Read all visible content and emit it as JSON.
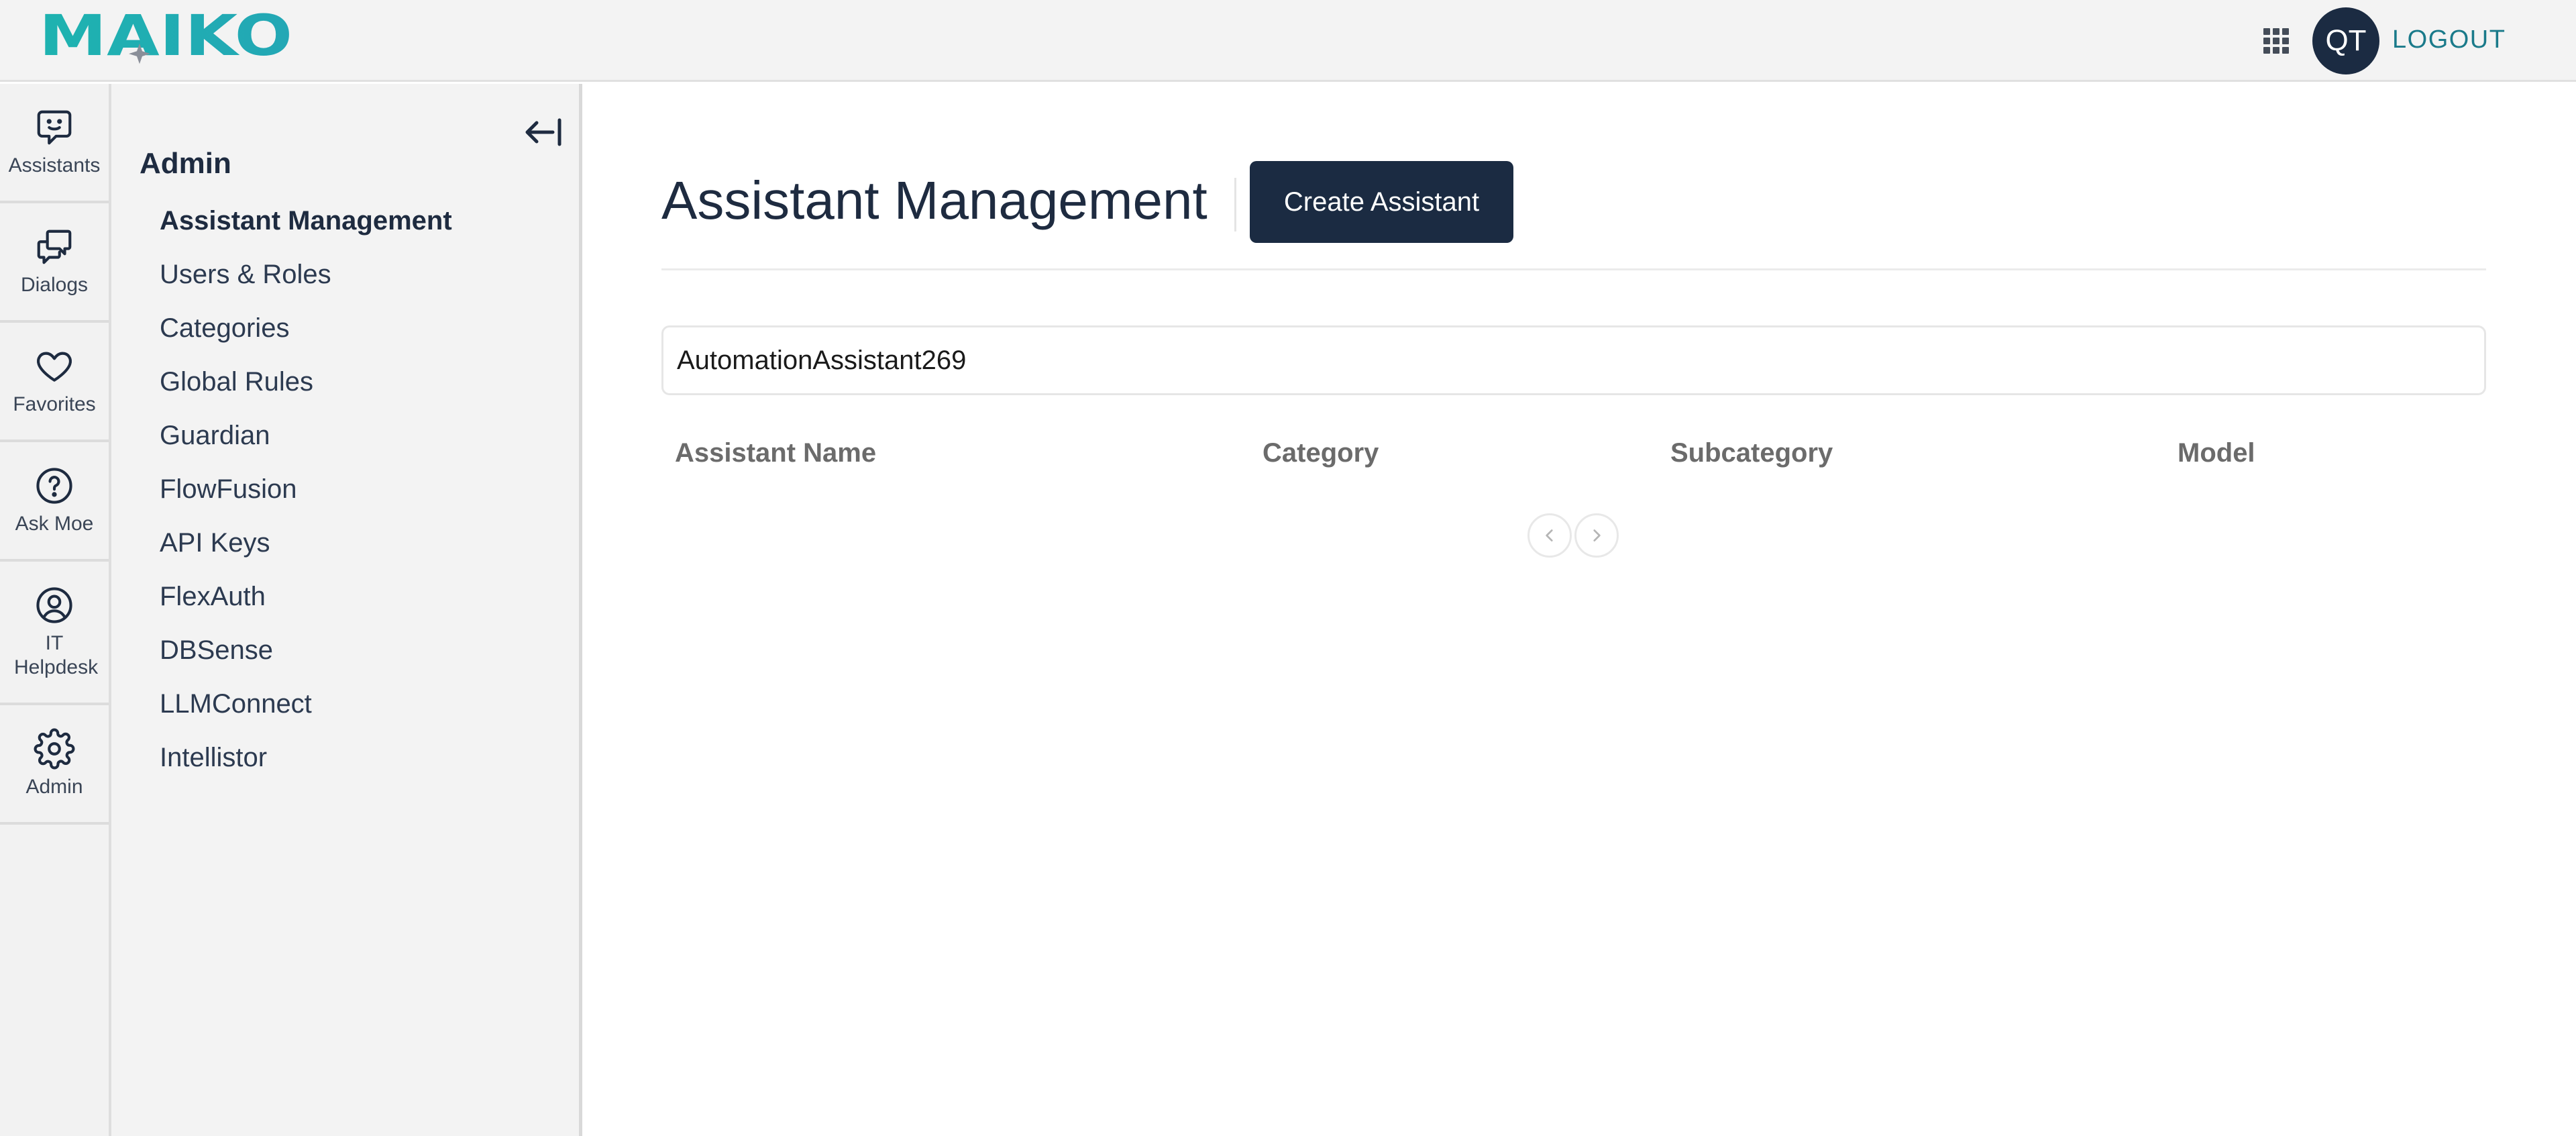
{
  "header": {
    "brand": "MAIKO",
    "user_initials": "QT",
    "logout_label": "LOGOUT",
    "brand_color": "#1aa6a8",
    "accent_color": "#1b2b42"
  },
  "rail": {
    "items": [
      {
        "label": "Assistants",
        "icon": "chat-smile-icon"
      },
      {
        "label": "Dialogs",
        "icon": "dialogs-icon"
      },
      {
        "label": "Favorites",
        "icon": "heart-icon"
      },
      {
        "label": "Ask Moe",
        "icon": "question-circle-icon"
      },
      {
        "label": "IT Helpdesk",
        "icon": "user-circle-icon"
      },
      {
        "label": "Admin",
        "icon": "gear-icon"
      }
    ]
  },
  "subnav": {
    "title": "Admin",
    "items": [
      {
        "label": "Assistant Management",
        "active": true
      },
      {
        "label": "Users & Roles"
      },
      {
        "label": "Categories"
      },
      {
        "label": "Global Rules"
      },
      {
        "label": "Guardian"
      },
      {
        "label": "FlowFusion"
      },
      {
        "label": "API Keys"
      },
      {
        "label": "FlexAuth"
      },
      {
        "label": "DBSense"
      },
      {
        "label": "LLMConnect"
      },
      {
        "label": "Intellistor"
      }
    ]
  },
  "main": {
    "title": "Assistant Management",
    "create_label": "Create Assistant",
    "search_value": "AutomationAssistant269",
    "table": {
      "columns": [
        "Assistant Name",
        "Category",
        "Subcategory",
        "Model"
      ],
      "rows": []
    }
  }
}
